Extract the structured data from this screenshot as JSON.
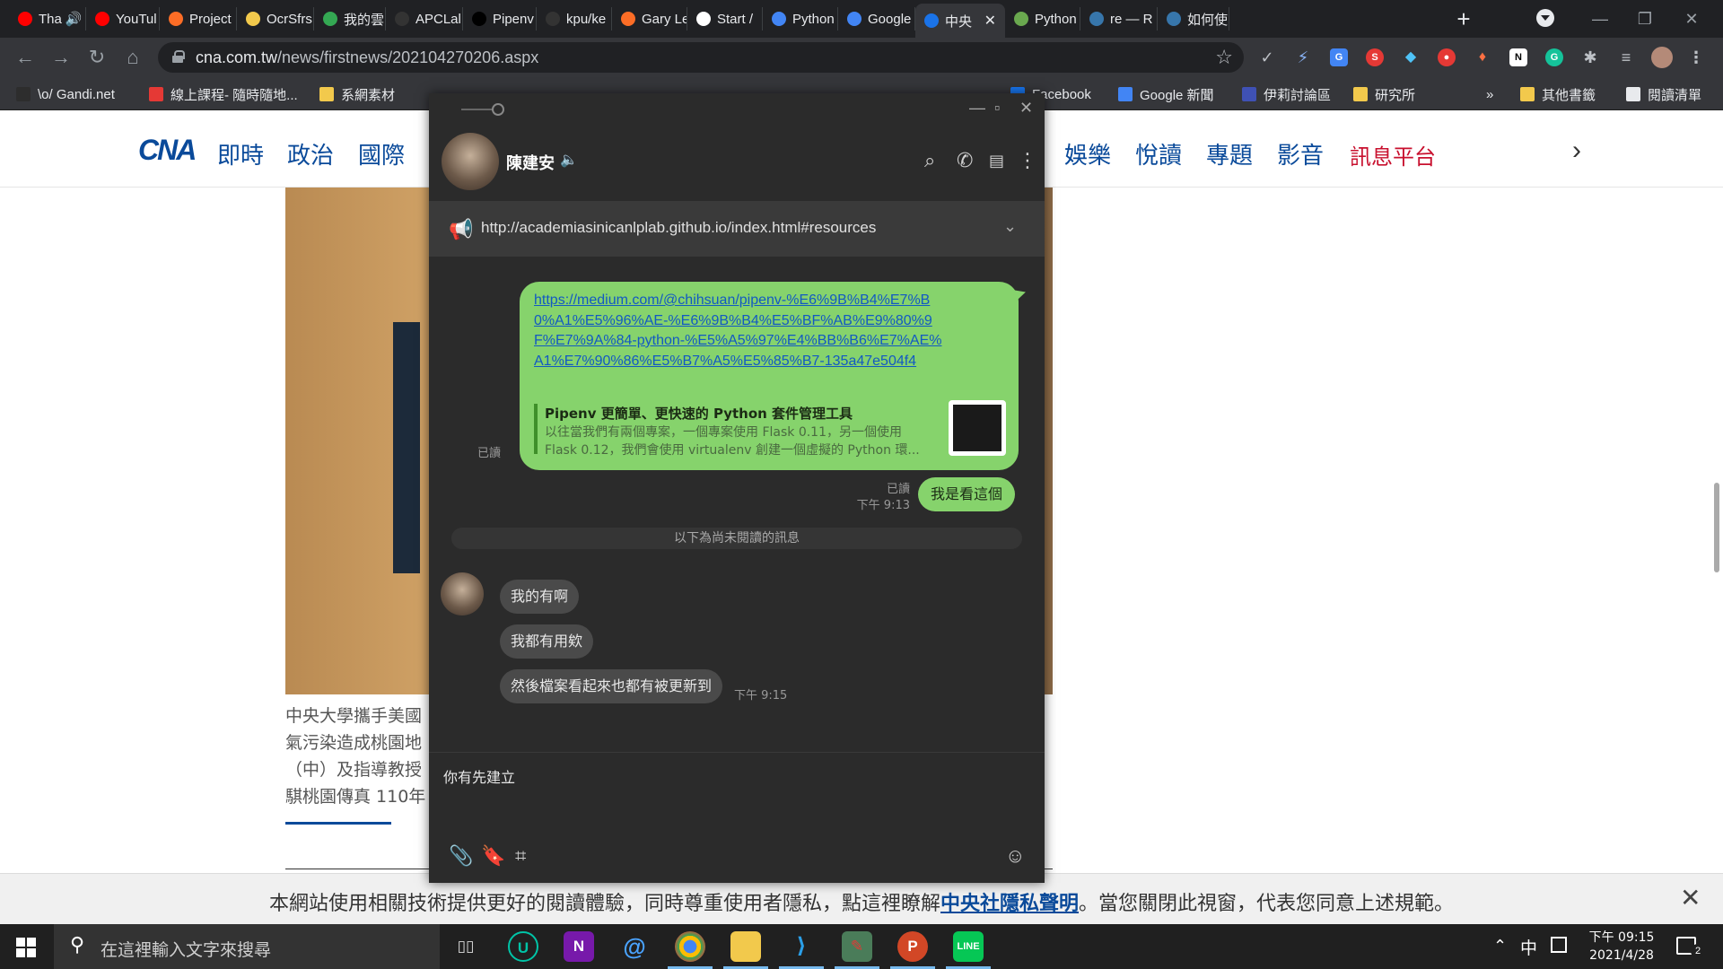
{
  "browser": {
    "tabs": [
      {
        "label": "Tha",
        "fav": "youtube-icon",
        "color": "#ff0000",
        "speaker": "🔊"
      },
      {
        "label": "YouTul",
        "fav": "youtube-icon",
        "color": "#ff0000"
      },
      {
        "label": "Project",
        "fav": "gitlab-icon",
        "color": "#fc6d26"
      },
      {
        "label": "OcrSfrs",
        "fav": "python-icon",
        "color": "#f2c94c"
      },
      {
        "label": "我的雲",
        "fav": "drive-icon",
        "color": "#34a853"
      },
      {
        "label": "APCLal",
        "fav": "github-icon",
        "color": "#333333"
      },
      {
        "label": "Pipenv",
        "fav": "medium-icon",
        "color": "#000000"
      },
      {
        "label": "kpu/ke",
        "fav": "github-icon",
        "color": "#333333"
      },
      {
        "label": "Gary Le",
        "fav": "gitlab-icon",
        "color": "#fc6d26"
      },
      {
        "label": "Start /",
        "fav": "notion-icon",
        "color": "#ffffff"
      },
      {
        "label": "Python",
        "fav": "generic-g-icon",
        "color": "#4285f4"
      },
      {
        "label": "Google",
        "fav": "google-translate-icon",
        "color": "#4285f4"
      },
      {
        "label": "中央",
        "fav": "cna-icon",
        "color": "#1a73e8",
        "close": "✕"
      },
      {
        "label": "Python",
        "fav": "python-icon",
        "color": "#6aa84f"
      },
      {
        "label": "re — R",
        "fav": "python-icon",
        "color": "#3776ab"
      },
      {
        "label": "如何使",
        "fav": "python-icon",
        "color": "#3776ab"
      }
    ],
    "new_tab": "+",
    "window_controls": {
      "minimize": "—",
      "maximize": "❐",
      "close": "✕"
    },
    "nav": {
      "back": "←",
      "forward": "→",
      "reload": "↻",
      "home": "⌂"
    },
    "url_host": "cna.com.tw",
    "url_path": "/news/firstnews/202104270206.aspx",
    "star": "☆",
    "bookmarks": [
      {
        "label": "\\o/ Gandi.net",
        "icon": "gandi-icon",
        "color": "#2d2d2d"
      },
      {
        "label": "線上課程- 隨時隨地...",
        "icon": "course-icon",
        "color": "#e53935"
      },
      {
        "label": "系網素材",
        "icon": "folder-icon",
        "color": "#f2c94c"
      },
      {
        "label": "Facebook",
        "icon": "facebook-icon",
        "color": "#1877f2"
      },
      {
        "label": "Google 新聞",
        "icon": "google-news-icon",
        "color": "#4285f4"
      },
      {
        "label": "伊莉討論區",
        "icon": "eyny-icon",
        "color": "#3f51b5"
      },
      {
        "label": "研究所",
        "icon": "folder-icon",
        "color": "#f2c94c"
      },
      {
        "label": "»",
        "icon": "",
        "color": ""
      },
      {
        "label": "其他書籤",
        "icon": "folder-icon",
        "color": "#f2c94c"
      },
      {
        "label": "閱讀清單",
        "icon": "reading-list-icon",
        "color": "#e8eaed"
      }
    ]
  },
  "page": {
    "logo": "CNA",
    "nav_items": [
      "即時",
      "政治",
      "國際",
      "娛樂",
      "悅讀",
      "專題",
      "影音",
      "訊息平台"
    ],
    "caption_lines": [
      "中央大學攜手美國",
      "氣污染造成桃園地",
      "（中）及指導教授",
      "騏桃園傳真 110年"
    ],
    "cookie_text_pre": "本網站使用相關技術提供更好的閱讀體驗，同時尊重使用者隱私，點這裡瞭解",
    "cookie_link": "中央社隱私聲明",
    "cookie_text_post": "。當您關閉此視窗，代表您同意上述規範。",
    "cookie_close": "✕"
  },
  "line": {
    "contact_name": "陳建安",
    "announcement": "http://academiasinicanlplab.github.io/index.html#resources",
    "messages": {
      "link": "https://medium.com/@chihsuan/pipenv-%E6%9B%B4%E7%B0%A1%E5%96%AE-%E6%9B%B4%E5%BF%AB%E9%80%9F%E7%9A%84-python-%E5%A5%97%E4%BB%B6%E7%AE%A1%E7%90%86%E5%B7%A5%E5%85%B7-135a47e504f4",
      "preview_title": "Pipenv 更簡單、更快速的 Python 套件管理工具",
      "preview_desc": "以往當我們有兩個專案，一個專案使用 Flask 0.11，另一個使用 Flask 0.12，我們會使用 virtualenv 創建一個虛擬的 Python 環...",
      "read_1": "已讀",
      "read_2": "已讀",
      "time_sent": "下午 9:13",
      "sent_short": "我是看這個",
      "unread_divider": "以下為尚未閱讀的訊息",
      "received": [
        "我的有啊",
        "我都有用欸",
        "然後檔案看起來也都有被更新到"
      ],
      "time_received": "下午 9:15"
    },
    "input_value": "你有先建立"
  },
  "taskbar": {
    "search_placeholder": "在這裡輸入文字來搜尋",
    "ime": "中",
    "time": "下午 09:15",
    "date": "2021/4/28",
    "notifications": "2"
  }
}
